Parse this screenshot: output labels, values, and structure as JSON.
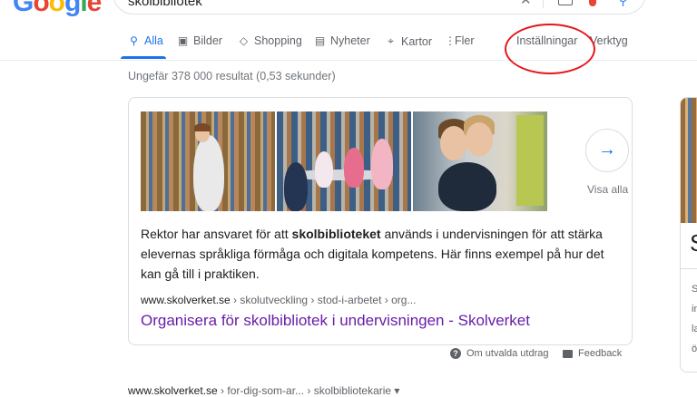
{
  "header": {
    "logo_letters": [
      "G",
      "o",
      "o",
      "g",
      "l",
      "e"
    ],
    "search_query": "skolbibliotek",
    "clear_icon": "close-icon",
    "search_icon": "search-icon"
  },
  "tabs": [
    {
      "label": "Alla",
      "icon": "search-icon",
      "glyph": "⚲",
      "active": true
    },
    {
      "label": "Bilder",
      "icon": "image-icon",
      "glyph": "▣",
      "active": false
    },
    {
      "label": "Shopping",
      "icon": "tag-icon",
      "glyph": "◇",
      "active": false
    },
    {
      "label": "Nyheter",
      "icon": "news-icon",
      "glyph": "▤",
      "active": false
    },
    {
      "label": "Kartor",
      "icon": "map-pin-icon",
      "glyph": "⌖",
      "active": false
    },
    {
      "label": "Fler",
      "icon": "more-vert-icon",
      "glyph": "⋮",
      "active": false
    },
    {
      "label": "Inställningar",
      "icon": "",
      "glyph": "",
      "active": false
    },
    {
      "label": "Verktyg",
      "icon": "",
      "glyph": "",
      "active": false
    }
  ],
  "stats": "Ungefär 378 000 resultat (0,53 sekunder)",
  "featured": {
    "visa_alla": "Visa alla",
    "next_glyph": "→",
    "snippet_before": "Rektor har ansvaret för att ",
    "snippet_bold": "skolbiblioteket",
    "snippet_after": " används i undervisningen för att stärka elevernas språkliga förmåga och digitala kompetens. Här finns exempel på hur det kan gå till i praktiken.",
    "cite_domain": "www.skolverket.se",
    "cite_path": " › skolutveckling › stod-i-arbetet › org...",
    "title": "Organisera för skolbibliotek i undervisningen - Skolverket"
  },
  "footer": {
    "about_label": "Om utvalda utdrag",
    "about_glyph": "?",
    "feedback_label": "Feedback"
  },
  "next_result": {
    "cite_domain": "www.skolverket.se",
    "cite_path": " › for-dig-som-ar... › skolbibliotekarie ▾"
  },
  "side_card": {
    "big_letter": "S",
    "letters": [
      "S",
      "in",
      "la",
      "ö"
    ]
  },
  "colors": {
    "link_visited": "#681da8",
    "active_tab": "#1a73e8",
    "annotation_circle": "#e8141b"
  }
}
